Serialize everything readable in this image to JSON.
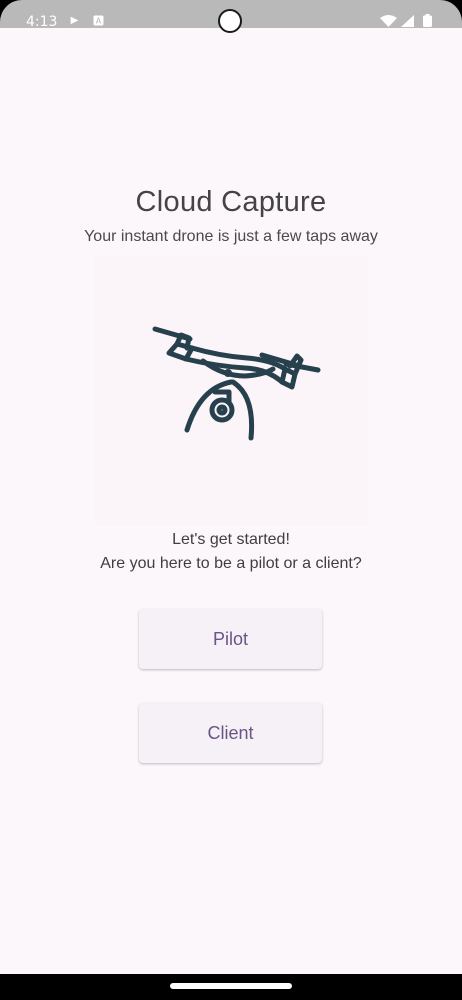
{
  "status_bar": {
    "time": "4:13",
    "icons": [
      "play-icon",
      "a-icon",
      "wifi-icon",
      "signal-icon",
      "battery-icon"
    ]
  },
  "app": {
    "title": "Cloud Capture",
    "subtitle": "Your instant drone is just a few taps away",
    "hero_image_icon": "drone-icon",
    "prompt_line_1": "Let's get started!",
    "prompt_line_2": "Are you here to be a pilot or a client?"
  },
  "buttons": {
    "pilot_label": "Pilot",
    "client_label": "Client"
  },
  "colors": {
    "background": "#fcf7fb",
    "button_background": "#f6f0f7",
    "button_text": "#6a5585",
    "drone_stroke": "#27404d"
  }
}
